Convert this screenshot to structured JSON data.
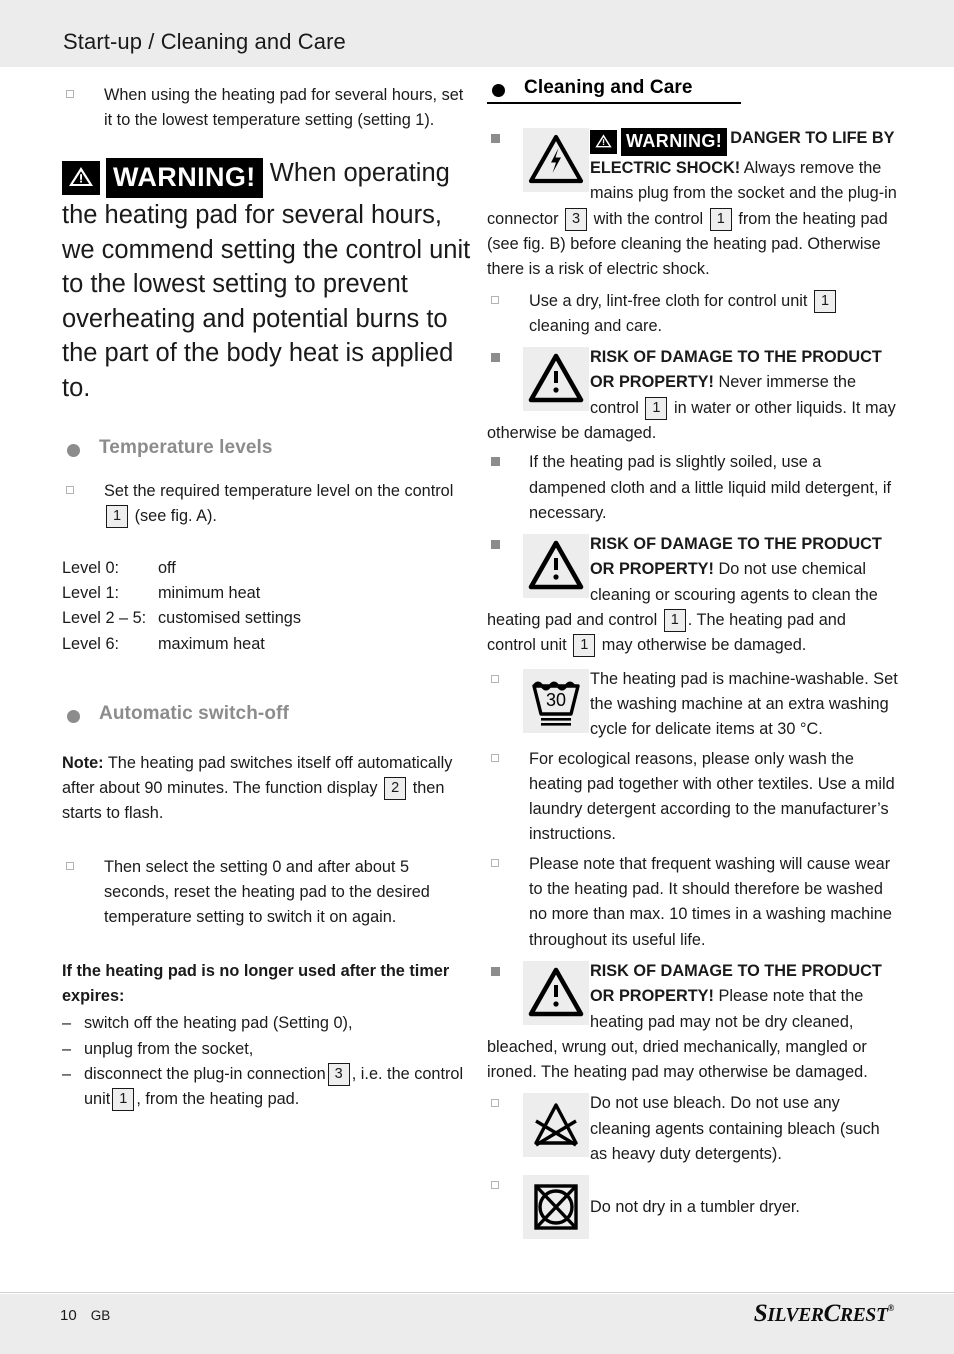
{
  "header": {
    "title": "Start-up / Cleaning and Care"
  },
  "left": {
    "intro_bullet": "When using the heating pad for several hours, set it to the lowest temperature setting (setting 1).",
    "warning_badge": "WARNING!",
    "warning_text": "When operating the heating pad for several hours, we commend setting the control unit to the lowest setting to prevent overheating and potential burns to the part of the body heat is applied to.",
    "temperature": {
      "heading": "Temperature levels",
      "bullet_a": "Set the required temperature level on the control",
      "bullet_a_ref": "1",
      "bullet_a_tail": "(see fig. A).",
      "levels": [
        {
          "key": "Level 0:",
          "value": "off"
        },
        {
          "key": "Level 1:",
          "value": "minimum heat"
        },
        {
          "key": "Level 2 – 5:",
          "value": "customised settings"
        },
        {
          "key": "Level 6:",
          "value": "maximum heat"
        }
      ]
    },
    "autooff": {
      "heading": "Automatic switch-off",
      "note_label": "Note:",
      "note_text_1": "The heating pad switches itself off automatically after about 90 minutes. The function display",
      "note_ref": "2",
      "note_text_2": "then starts to flash.",
      "bullet": "Then select the setting 0 and after about 5 seconds, reset the heating pad to the desired temperature setting to switch it on again.",
      "timer_heading": "If the heating pad is no longer used after the timer expires:",
      "dash_items": [
        {
          "text": "switch off the heating pad (Setting 0),"
        },
        {
          "text": "unplug from the socket,"
        },
        {
          "text_pre": "disconnect the plug-in connection",
          "ref1": "3",
          "text_mid": ", i.e. the control unit",
          "ref2": "1",
          "text_post": ", from the heating pad."
        }
      ]
    }
  },
  "right": {
    "heading": "Cleaning and Care",
    "item_shock": {
      "icon": "electric-shock-icon",
      "badge": "WARNING!",
      "bold": "DANGER TO LIFE BY ELECTRIC SHOCK!",
      "text_1": "Always remove the mains plug from the socket and the plug-in connector",
      "ref1": "3",
      "text_2": "with the control",
      "ref2": "1",
      "text_3": "from the heating pad (see fig. B) before cleaning the heating pad. Otherwise there is a risk of electric shock."
    },
    "item_cloth": {
      "text_1": "Use a dry, lint-free cloth for control unit",
      "ref1": "1",
      "text_2": "cleaning and care."
    },
    "item_immerse": {
      "icon": "warning-triangle-icon",
      "bold": "RISK OF DAMAGE TO THE PRODUCT OR PROPERTY!",
      "text_1": "Never immerse the control",
      "ref1": "1",
      "text_2": "in water or other liquids. It may otherwise be damaged."
    },
    "item_soiled": {
      "text": "If the heating pad is slightly soiled, use a dampened cloth and a little liquid mild detergent, if necessary."
    },
    "item_chemical": {
      "icon": "warning-triangle-icon",
      "bold": "RISK OF DAMAGE TO THE PRODUCT OR PROPERTY!",
      "text_1": "Do not use chemical cleaning or scouring agents to clean the heating pad and control",
      "ref1": "1",
      "text_2": ". The heating pad and control unit",
      "ref2": "1",
      "text_3": "may otherwise be damaged."
    },
    "item_machine": {
      "icon": "wash-30-icon",
      "icon_label": "30",
      "text": "The heating pad is machine-washable. Set the washing machine at an extra washing cycle for delicate items at 30 °C."
    },
    "item_ecological": {
      "text": "For ecological reasons, please only wash the heating pad together with other textiles. Use a mild laundry detergent according to the manufacturer’s instructions."
    },
    "item_frequent": {
      "text": "Please note that frequent washing will cause wear to the heating pad. It should therefore be washed no more than max. 10 times in a washing machine throughout its useful life."
    },
    "item_drycleaned": {
      "icon": "warning-triangle-icon",
      "bold": "RISK OF DAMAGE TO THE PRODUCT OR PROPERTY!",
      "text_1": "Please note that the heating pad may not be dry cleaned, bleached, wrung out, dried mechanically, mangled or ironed. The heating pad may otherwise be damaged."
    },
    "item_bleach": {
      "icon": "no-bleach-icon",
      "text": "Do not use bleach. Do not use any cleaning agents containing bleach (such as heavy duty detergents)."
    },
    "item_tumble": {
      "icon": "no-tumble-dry-icon",
      "text": "Do not dry in a tumbler dryer."
    }
  },
  "footer": {
    "page_number": "10",
    "language": "GB",
    "brand_part1": "S",
    "brand_part2": "ILVER",
    "brand_part3": "C",
    "brand_part4": "REST",
    "brand_reg": "®"
  },
  "colors": {
    "header_band": "#ececec",
    "gray_heading": "#8c8c8c",
    "icon_box": "#ededed",
    "ref_box_fill": "#eeeeee"
  }
}
